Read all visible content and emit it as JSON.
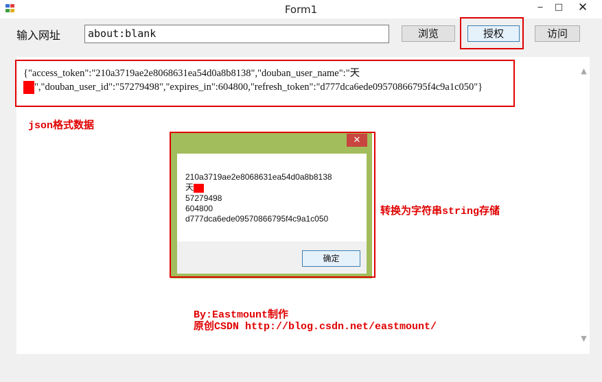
{
  "window": {
    "title": "Form1",
    "minimize": "‒",
    "maximize": "□",
    "close": "✕"
  },
  "toolbar": {
    "url_label": "输入网址",
    "url_value": "about:blank",
    "browse_label": "浏览",
    "authorize_label": "授权",
    "visit_label": "访问"
  },
  "browser": {
    "json_part1": "{\"access_token\":\"210a3719ae2e8068631ea54d0a8b8138\",\"douban_user_name\":\"天",
    "json_part2": "\",\"douban_user_id\":\"57279498\",\"expires_in\":604800,\"refresh_token\":\"d777dca6ede09570866795f4c9a1c050\"}",
    "scroll_up": "▲",
    "scroll_down": "▼"
  },
  "annotations": {
    "json_caption": "json格式数据",
    "convert_caption": "转换为字符串string存储",
    "credit_line1": "By:Eastmount制作",
    "credit_line2": "原创CSDN http://blog.csdn.net/eastmount/"
  },
  "dialog": {
    "close": "✕",
    "line1": "210a3719ae2e8068631ea54d0a8b8138",
    "line2": "天",
    "line3": "57279498",
    "line4": "604800",
    "line5": "d777dca6ede09570866795f4c9a1c050",
    "ok_label": "确定"
  },
  "colors": {
    "annotation_red": "#e00000",
    "dialog_frame": "#a2bd5b",
    "redaction": "#ff0000"
  }
}
